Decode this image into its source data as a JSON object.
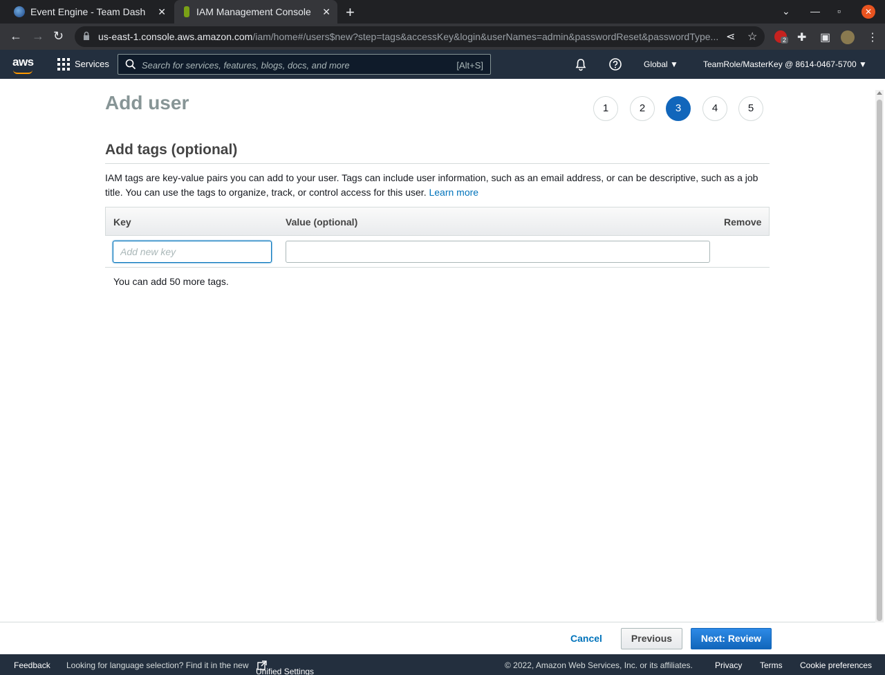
{
  "browser": {
    "tabs": [
      {
        "title": "Event Engine - Team Dash"
      },
      {
        "title": "IAM Management Console"
      }
    ],
    "url_host": "us-east-1.console.aws.amazon.com",
    "url_path": "/iam/home#/users$new?step=tags&accessKey&login&userNames=admin&passwordReset&passwordType...",
    "extension_badge": "2",
    "icons": [
      "back-icon",
      "forward-icon",
      "reload-icon",
      "lock-icon",
      "share-icon",
      "star-icon",
      "puzzle-icon",
      "sidepanel-icon",
      "menu-icon"
    ]
  },
  "aws_header": {
    "logo": "aws",
    "services_label": "Services",
    "search_placeholder": "Search for services, features, blogs, docs, and more",
    "search_shortcut": "[Alt+S]",
    "region": "Global ▼",
    "account": "TeamRole/MasterKey @ 8614-0467-5700 ▼"
  },
  "page": {
    "title": "Add user",
    "steps": [
      "1",
      "2",
      "3",
      "4",
      "5"
    ],
    "active_step": "3",
    "section_title": "Add tags (optional)",
    "description": "IAM tags are key-value pairs you can add to your user. Tags can include user information, such as an email address, or can be descriptive, such as a job title. You can use the tags to organize, track, or control access for this user.",
    "learn_more": "Learn more",
    "table": {
      "headers": {
        "key": "Key",
        "value": "Value (optional)",
        "remove": "Remove"
      },
      "key_placeholder": "Add new key",
      "key_value": "",
      "value_value": ""
    },
    "hint": "You can add 50 more tags."
  },
  "actions": {
    "cancel": "Cancel",
    "previous": "Previous",
    "next": "Next: Review"
  },
  "footer": {
    "feedback": "Feedback",
    "language_note": "Looking for language selection? Find it in the new",
    "unified_settings": "Unified Settings",
    "copyright": "© 2022, Amazon Web Services, Inc. or its affiliates.",
    "privacy": "Privacy",
    "terms": "Terms",
    "cookies": "Cookie preferences"
  },
  "colors": {
    "aws_nav": "#232f3e",
    "accent": "#0073bb",
    "primary_button": "#1166bb",
    "aws_orange": "#ff9900"
  }
}
